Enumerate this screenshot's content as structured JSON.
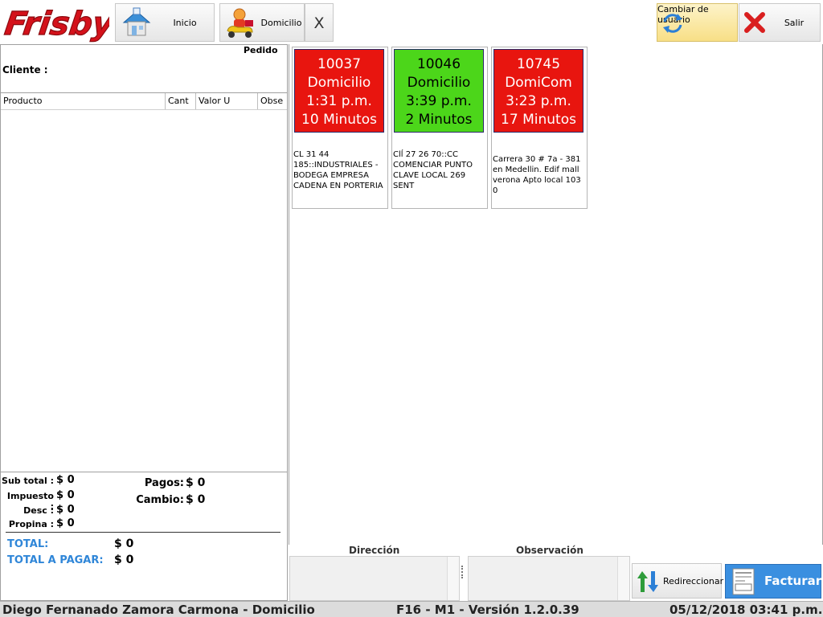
{
  "topbar": {
    "logo_text": "Frisby",
    "inicio_label": "Inicio",
    "domicilio_label": "Domicilio",
    "close_label": "X",
    "cambiar_label_1": "Cambiar de",
    "cambiar_label_2": "usuario",
    "salir_label": "Salir"
  },
  "left": {
    "pedido_label": "Pedido",
    "cliente_label": "Cliente :",
    "columns": [
      "Producto",
      "Cant",
      "Valor U",
      "Obse"
    ],
    "subtotal_label": "Sub total :",
    "subtotal_value": "$ 0",
    "impuesto_label": "Impuesto :",
    "impuesto_value": "$ 0",
    "desc_label": "Desc :",
    "desc_value": "$ 0",
    "propina_label": "Propina :",
    "propina_value": "$ 0",
    "pagos_label": "Pagos:",
    "pagos_value": "$ 0",
    "cambio_label": "Cambio:",
    "cambio_value": "$ 0",
    "total_label": "TOTAL:",
    "total_value": "$ 0",
    "total_pagar_label": "TOTAL A PAGAR:",
    "total_pagar_value": "$ 0"
  },
  "orders": [
    {
      "number": "10037",
      "type": "Domicilio",
      "time": "1:31 p.m.",
      "elapsed": "10 Minutos",
      "color": "#e8150f",
      "text_color": "#ffffff",
      "address": [
        "CL 31  44",
        "185::INDUSTRIALES -",
        "BODEGA EMPRESA",
        "CADENA EN PORTERIA"
      ]
    },
    {
      "number": "10046",
      "type": "Domicilio",
      "time": "3:39 p.m.",
      "elapsed": "2 Minutos",
      "color": "#4cd61a",
      "text_color": "#000000",
      "address": [
        "Clĺ 27   26 70::CC",
        "COMENCIAR PUNTO",
        "CLAVE LOCAL 269",
        "SENT"
      ]
    },
    {
      "number": "10745",
      "type": "DomiCom",
      "time": "3:23 p.m.",
      "elapsed": "17 Minutos",
      "color": "#e8150f",
      "text_color": "#ffffff",
      "address": [
        "Carrera 30 # 7a - 381",
        "en Medellin. Edif mall",
        "verona Apto local 103 0"
      ]
    }
  ],
  "bottom": {
    "direccion_label": "Dirección",
    "observacion_label": "Observación",
    "redireccionar_label": "Redireccionar",
    "facturar_label": "Facturar"
  },
  "status": {
    "user": "Diego Fernanado  Zamora Carmona - Domicilio",
    "version": "F16 - M1  -  Versión 1.2.0.39",
    "datetime": "05/12/2018 03:41 p.m."
  },
  "colors": {
    "accent_blue": "#2f86d8",
    "order_red": "#e8150f",
    "order_green": "#4cd61a"
  }
}
